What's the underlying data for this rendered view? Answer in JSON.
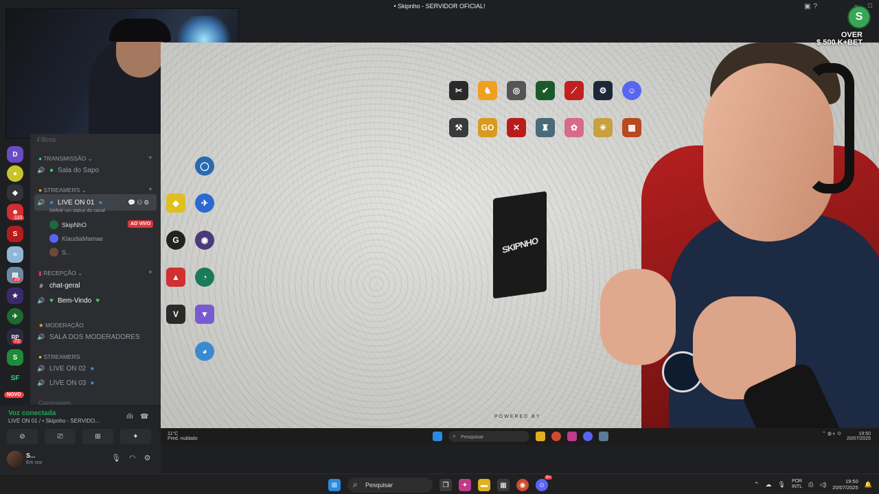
{
  "title_bar": {
    "title": "• Skipnho - SERVIDOR OFICIAL!"
  },
  "channels": {
    "top_faded": "Filtros",
    "categories": [
      {
        "label": "TRANSMISSÃO ⌄"
      },
      {
        "label": "STREAMERS ⌄"
      },
      {
        "label": "Recepção ⌄"
      },
      {
        "label": "MODERAÇÃO"
      },
      {
        "label": "STREAMERS"
      }
    ],
    "sala_do_sapo": "Sala do Sapo",
    "live_on_01": "LIVE ON 01",
    "live_on_01_status": "Definir um status do canal",
    "users": [
      "SkipNhO",
      "KlaudiaMamae",
      "S..."
    ],
    "live_badge": "AO VIVO",
    "chat_geral": "chat-geral",
    "bem_vindo": "Bem-Vindo",
    "sala_moderadores": "SALA DOS MODERADORES",
    "live_on_02": "LIVE ON 02",
    "live_on_03": "LIVE ON 03",
    "bottom_faded": "Cassinagem"
  },
  "servers": {
    "badges": [
      "110",
      "29",
      "72"
    ],
    "new_label": "NOVO"
  },
  "voice": {
    "title": "Voz conectada",
    "subtitle": "LIVE ON 01 / • Skipnho - SERVIDO...",
    "user_name": "S...",
    "user_status": "Em voz"
  },
  "stream": {
    "overlay_over": "OVER",
    "overlay_brand": "$ 500 K+BET",
    "logo_text": "SKIPNHO",
    "powered": "POWERED BY"
  },
  "inner_taskbar": {
    "weather_temp": "11°C",
    "weather_desc": "Pred. nublado",
    "search_placeholder": "Pesquisar",
    "time": "19:50",
    "date": "20/07/2025"
  },
  "taskbar": {
    "search_placeholder": "Pesquisar",
    "lang_line1": "POR",
    "lang_line2": "INTL",
    "time": "19:50",
    "date": "20/07/2025",
    "discord_badge": "9+"
  }
}
